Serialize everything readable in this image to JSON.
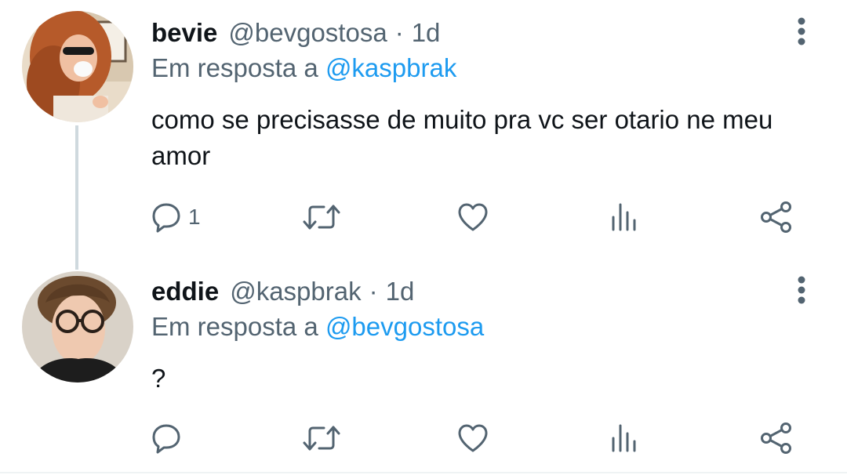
{
  "tweets": [
    {
      "name": "bevie",
      "handle": "@bevgostosa",
      "separator": "·",
      "time": "1d",
      "reply_prefix": "Em resposta a",
      "reply_to": "@kaspbrak",
      "text": "como se precisasse de muito pra vc ser otario ne meu amor",
      "reply_count": "1",
      "avatar": "avatar-red-haired-woman-sunglasses"
    },
    {
      "name": "eddie",
      "handle": "@kaspbrak",
      "separator": "·",
      "time": "1d",
      "reply_prefix": "Em resposta a",
      "reply_to": "@bevgostosa",
      "text": "?",
      "reply_count": "",
      "avatar": "avatar-young-man-glasses"
    }
  ],
  "icons": {
    "reply": "speech-bubble-icon",
    "retweet": "retweet-icon",
    "like": "heart-icon",
    "views": "bar-chart-icon",
    "share": "share-icon",
    "more": "more-vertical-icon"
  },
  "colors": {
    "text": "#0f1419",
    "secondary": "#536471",
    "link": "#1d9bf0",
    "icon": "#536471",
    "thread_line": "#cfd9de"
  }
}
